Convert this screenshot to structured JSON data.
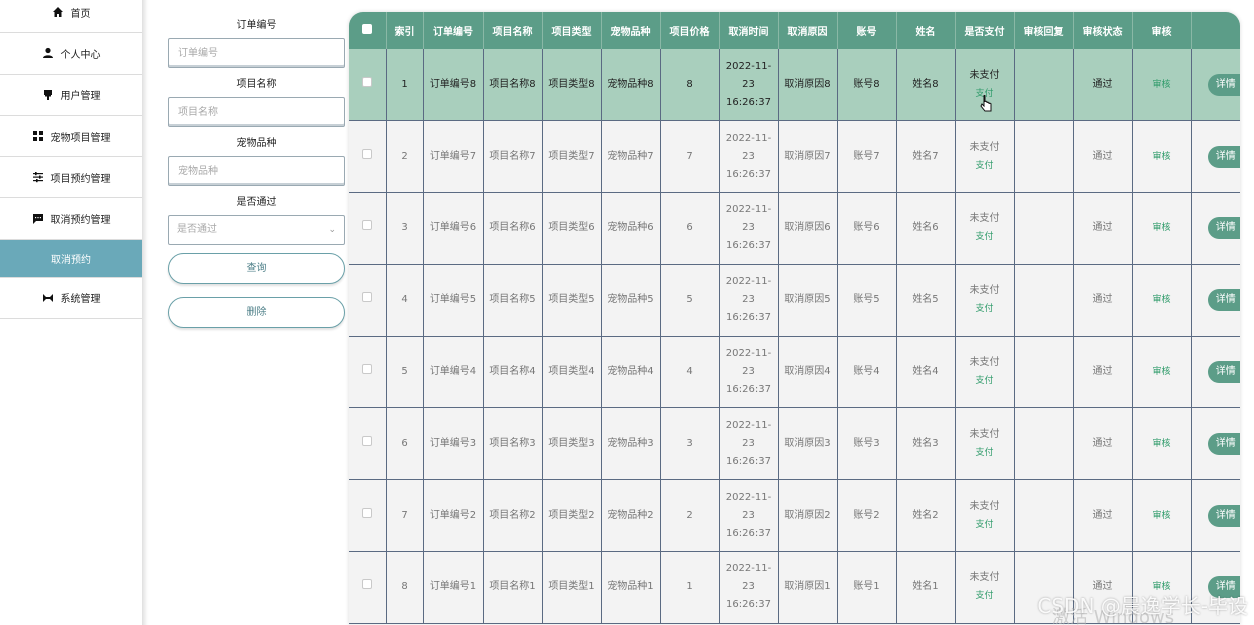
{
  "sidebar": {
    "items": [
      {
        "label": "首页",
        "icon": "home-icon"
      },
      {
        "label": "个人中心",
        "icon": "user-icon"
      },
      {
        "label": "用户管理",
        "icon": "user-manage-icon"
      },
      {
        "label": "宠物项目管理",
        "icon": "grid-icon"
      },
      {
        "label": "项目预约管理",
        "icon": "sliders-icon"
      },
      {
        "label": "取消预约管理",
        "icon": "chat-icon"
      },
      {
        "label": "取消预约",
        "icon": ""
      },
      {
        "label": "系统管理",
        "icon": "system-icon"
      }
    ],
    "active_index": 6
  },
  "filters": {
    "order_no": {
      "label": "订单编号",
      "placeholder": "订单编号"
    },
    "project_name": {
      "label": "项目名称",
      "placeholder": "项目名称"
    },
    "pet_breed": {
      "label": "宠物品种",
      "placeholder": "宠物品种"
    },
    "passed": {
      "label": "是否通过",
      "placeholder": "是否通过"
    },
    "search_label": "查询",
    "delete_label": "删除"
  },
  "table": {
    "headers": [
      "索引",
      "订单编号",
      "项目名称",
      "项目类型",
      "宠物品种",
      "项目价格",
      "取消时间",
      "取消原因",
      "账号",
      "姓名",
      "是否支付",
      "审核回复",
      "审核状态",
      "审核",
      ""
    ],
    "rows": [
      {
        "index": "1",
        "order": "订单编号8",
        "name": "项目名称8",
        "type": "项目类型8",
        "breed": "宠物品种8",
        "price": "8",
        "time": "2022-11-23 16:26:37",
        "reason": "取消原因8",
        "account": "账号8",
        "person": "姓名8",
        "pay_status": "未支付",
        "pay_link": "支付",
        "reply": "",
        "audit_status": "通过",
        "audit": "审核",
        "detail": "详情"
      },
      {
        "index": "2",
        "order": "订单编号7",
        "name": "项目名称7",
        "type": "项目类型7",
        "breed": "宠物品种7",
        "price": "7",
        "time": "2022-11-23 16:26:37",
        "reason": "取消原因7",
        "account": "账号7",
        "person": "姓名7",
        "pay_status": "未支付",
        "pay_link": "支付",
        "reply": "",
        "audit_status": "通过",
        "audit": "审核",
        "detail": "详情"
      },
      {
        "index": "3",
        "order": "订单编号6",
        "name": "项目名称6",
        "type": "项目类型6",
        "breed": "宠物品种6",
        "price": "6",
        "time": "2022-11-23 16:26:37",
        "reason": "取消原因6",
        "account": "账号6",
        "person": "姓名6",
        "pay_status": "未支付",
        "pay_link": "支付",
        "reply": "",
        "audit_status": "通过",
        "audit": "审核",
        "detail": "详情"
      },
      {
        "index": "4",
        "order": "订单编号5",
        "name": "项目名称5",
        "type": "项目类型5",
        "breed": "宠物品种5",
        "price": "5",
        "time": "2022-11-23 16:26:37",
        "reason": "取消原因5",
        "account": "账号5",
        "person": "姓名5",
        "pay_status": "未支付",
        "pay_link": "支付",
        "reply": "",
        "audit_status": "通过",
        "audit": "审核",
        "detail": "详情"
      },
      {
        "index": "5",
        "order": "订单编号4",
        "name": "项目名称4",
        "type": "项目类型4",
        "breed": "宠物品种4",
        "price": "4",
        "time": "2022-11-23 16:26:37",
        "reason": "取消原因4",
        "account": "账号4",
        "person": "姓名4",
        "pay_status": "未支付",
        "pay_link": "支付",
        "reply": "",
        "audit_status": "通过",
        "audit": "审核",
        "detail": "详情"
      },
      {
        "index": "6",
        "order": "订单编号3",
        "name": "项目名称3",
        "type": "项目类型3",
        "breed": "宠物品种3",
        "price": "3",
        "time": "2022-11-23 16:26:37",
        "reason": "取消原因3",
        "account": "账号3",
        "person": "姓名3",
        "pay_status": "未支付",
        "pay_link": "支付",
        "reply": "",
        "audit_status": "通过",
        "audit": "审核",
        "detail": "详情"
      },
      {
        "index": "7",
        "order": "订单编号2",
        "name": "项目名称2",
        "type": "项目类型2",
        "breed": "宠物品种2",
        "price": "2",
        "time": "2022-11-23 16:26:37",
        "reason": "取消原因2",
        "account": "账号2",
        "person": "姓名2",
        "pay_status": "未支付",
        "pay_link": "支付",
        "reply": "",
        "audit_status": "通过",
        "audit": "审核",
        "detail": "详情"
      },
      {
        "index": "8",
        "order": "订单编号1",
        "name": "项目名称1",
        "type": "项目类型1",
        "breed": "宠物品种1",
        "price": "1",
        "time": "2022-11-23 16:26:37",
        "reason": "取消原因1",
        "account": "账号1",
        "person": "姓名1",
        "pay_status": "未支付",
        "pay_link": "支付",
        "reply": "",
        "audit_status": "通过",
        "audit": "审核",
        "detail": "详情"
      }
    ],
    "selected_row": 0
  },
  "watermark": "CSDN @晨逸学长-毕设",
  "os_watermark": "激活 Windows",
  "colors": {
    "header_bg": "#5c9d88",
    "active_nav": "#6aa9b9",
    "selected_row": "#a9cfbd",
    "link": "#2f9b6a"
  }
}
